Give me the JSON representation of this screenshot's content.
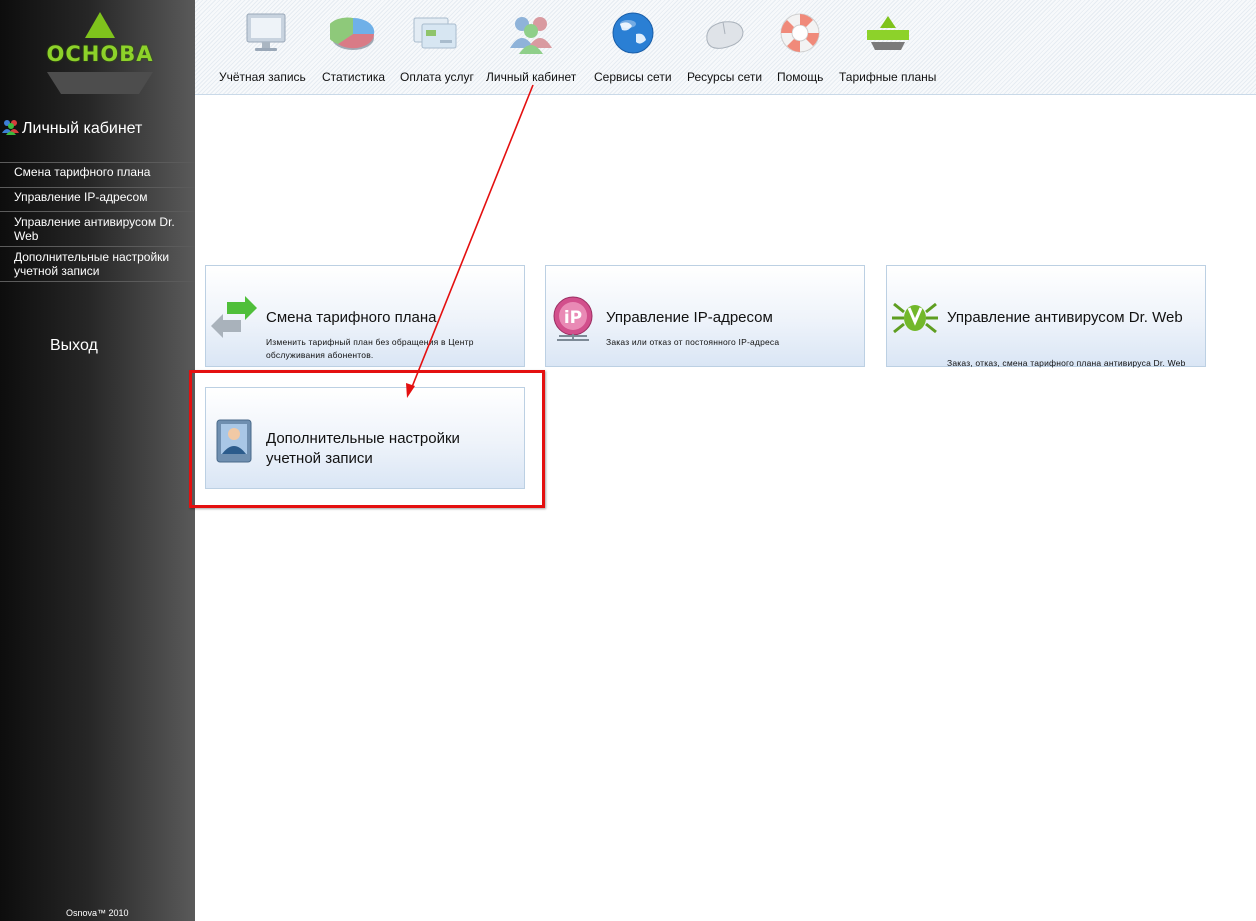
{
  "logo": {
    "text": "ОСНОВА",
    "color": "#8dd22a"
  },
  "sidebar": {
    "section_title": "Личный кабинет",
    "section_icon": "users-icon",
    "items": [
      {
        "label": "Смена тарифного плана"
      },
      {
        "label": "Управление IP-адресом"
      },
      {
        "label": "Управление антивирусом Dr. Web"
      },
      {
        "label": "Дополнительные настройки учетной записи"
      }
    ],
    "logout": "Выход",
    "copyright": "Osnova™ 2010"
  },
  "topnav": {
    "items": [
      {
        "label": "Учётная запись",
        "icon": "monitor-icon"
      },
      {
        "label": "Статистика",
        "icon": "pie-chart-icon"
      },
      {
        "label": "Оплата услуг",
        "icon": "payment-cards-icon"
      },
      {
        "label": "Личный кабинет",
        "icon": "users-icon"
      },
      {
        "label": "Сервисы сети",
        "icon": "globe-icon"
      },
      {
        "label": "Ресурсы сети",
        "icon": "mouse-icon"
      },
      {
        "label": "Помощь",
        "icon": "lifebuoy-icon"
      },
      {
        "label": "Тарифные планы",
        "icon": "osnova-logo-icon"
      }
    ]
  },
  "cards": [
    {
      "title": "Смена тарифного плана",
      "desc": "Изменить тарифный план без обращения в Центр обслуживания абонентов.",
      "icon": "swap-arrows-icon"
    },
    {
      "title": "Управление IP-адресом",
      "desc": "Заказ или отказ от постоянного IP-адреса",
      "icon": "ip-address-icon"
    },
    {
      "title": "Управление антивирусом Dr. Web",
      "desc": "Заказ, отказ, смена тарифного плана антивируса Dr. Web",
      "icon": "drweb-spider-icon"
    },
    {
      "title": "Дополнительные настройки учетной записи",
      "desc": "",
      "icon": "user-profile-icon"
    }
  ],
  "annotation": {
    "highlight_color": "#e41010",
    "arrow_target": "Дополнительные настройки учетной записи"
  }
}
